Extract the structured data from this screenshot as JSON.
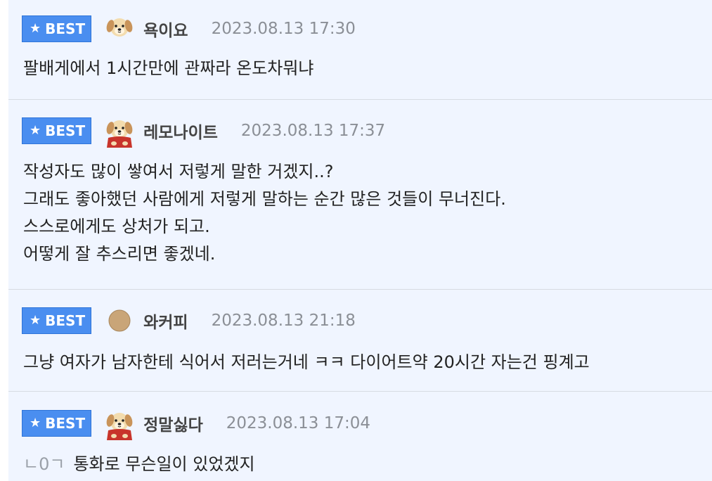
{
  "comments": [
    {
      "badge": "BEST",
      "avatar": "puppy-icon",
      "nickname": "욕이요",
      "timestamp": "2023.08.13 17:30",
      "lines": [
        "팔배게에서 1시간만에 관짜라 온도차뭐냐"
      ]
    },
    {
      "badge": "BEST",
      "avatar": "puppy-cape-icon",
      "nickname": "레모나이트",
      "timestamp": "2023.08.13 17:37",
      "lines": [
        "작성자도 많이 쌓여서 저렇게 말한 거겠지..?",
        "그래도 좋아했던 사람에게 저렇게 말하는 순간 많은 것들이 무너진다.",
        "스스로에게도 상처가 되고.",
        "어떻게 잘 추스리면 좋겠네."
      ]
    },
    {
      "badge": "BEST",
      "avatar": "brown-circle-icon",
      "nickname": "와커피",
      "timestamp": "2023.08.13 21:18",
      "lines": [
        "그냥 여자가 남자한테 식어서 저러는거네 ㅋㅋ 다이어트약 20시간 자는건 핑계고"
      ]
    },
    {
      "badge": "BEST",
      "avatar": "puppy-cape-icon",
      "nickname": "정말싫다",
      "timestamp": "2023.08.13 17:04",
      "reply_mark": "ㄴ0ㄱ",
      "lines": [
        "통화로 무슨일이 있었겠지"
      ]
    }
  ],
  "colors": {
    "badge": "#4a8ef0",
    "background": "#f0f5ff",
    "timestamp": "#8b8f96"
  }
}
